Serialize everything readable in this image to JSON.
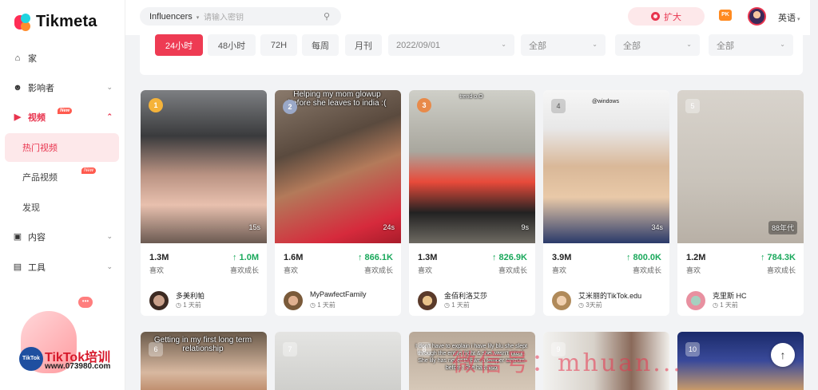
{
  "brand": {
    "name": "Tikmeta"
  },
  "sidebar": {
    "items": [
      {
        "label": "家",
        "icon": "home-icon"
      },
      {
        "label": "影响者",
        "icon": "user-icon"
      },
      {
        "label": "视频",
        "icon": "video-icon",
        "badge": "New"
      },
      {
        "label": "热门视频"
      },
      {
        "label": "产品视频",
        "badge": "New"
      },
      {
        "label": "发现"
      },
      {
        "label": "内容",
        "icon": "folder-icon"
      },
      {
        "label": "工具",
        "icon": "toolbox-icon"
      }
    ],
    "promo": {
      "circle": "TikTok",
      "title": "TikTok培训",
      "url": "www.073980.com",
      "bubble": "•••"
    }
  },
  "header": {
    "search_type": "Influencers",
    "search_placeholder": "请输入密钥",
    "expand_label": "扩大",
    "pk_label": "PK",
    "language": "英语"
  },
  "filters": {
    "time_tabs": [
      "24小时",
      "48小时",
      "72H",
      "每周",
      "月刊"
    ],
    "active_tab": "24小时",
    "date": "2022/09/01",
    "dropdowns": [
      "全部",
      "全部",
      "全部"
    ]
  },
  "videos": [
    {
      "rank": "1",
      "duration": "15s",
      "likes": "1.3M",
      "likes_label": "喜欢",
      "growth": "↑ 1.0M",
      "growth_label": "喜欢成长",
      "author": "多美利帕",
      "time": "1 天前",
      "overlay": ""
    },
    {
      "rank": "2",
      "duration": "24s",
      "likes": "1.6M",
      "likes_label": "喜欢",
      "growth": "↑ 866.1K",
      "growth_label": "喜欢成长",
      "author": "MyPawfectFamily",
      "time": "1 天前",
      "overlay": "Helping my mom glowup before she leaves to india :("
    },
    {
      "rank": "3",
      "duration": "9s",
      "likes": "1.3M",
      "likes_label": "喜欢",
      "growth": "↑ 826.9K",
      "growth_label": "喜欢成长",
      "author": "金佰利洛艾莎",
      "time": "1 天前",
      "overlay": "trend o.O"
    },
    {
      "rank": "4",
      "duration": "34s",
      "likes": "3.9M",
      "likes_label": "喜欢",
      "growth": "↑ 800.0K",
      "growth_label": "喜欢成长",
      "author": "艾米丽的TikTok.edu",
      "time": "3天前",
      "overlay": "@windows"
    },
    {
      "rank": "5",
      "duration": "88年代",
      "likes": "1.2M",
      "likes_label": "喜欢",
      "growth": "↑ 784.3K",
      "growth_label": "喜欢成长",
      "author": "克里斯 HC",
      "time": "1 天前",
      "overlay": ""
    }
  ],
  "videos_row2": [
    {
      "rank": "6",
      "overlay": "Getting in my first long term relationship"
    },
    {
      "rank": "7",
      "overlay": ""
    },
    {
      "rank": "8",
      "overlay": "I don't have to explain i have lily blu she slept through the entire night & she wasn't into it. She lily has never thrown a temper tantrum before. She has also"
    },
    {
      "rank": "9",
      "overlay": ""
    },
    {
      "rank": "10",
      "overlay": ""
    }
  ],
  "watermark": "微信号：mhuan..."
}
